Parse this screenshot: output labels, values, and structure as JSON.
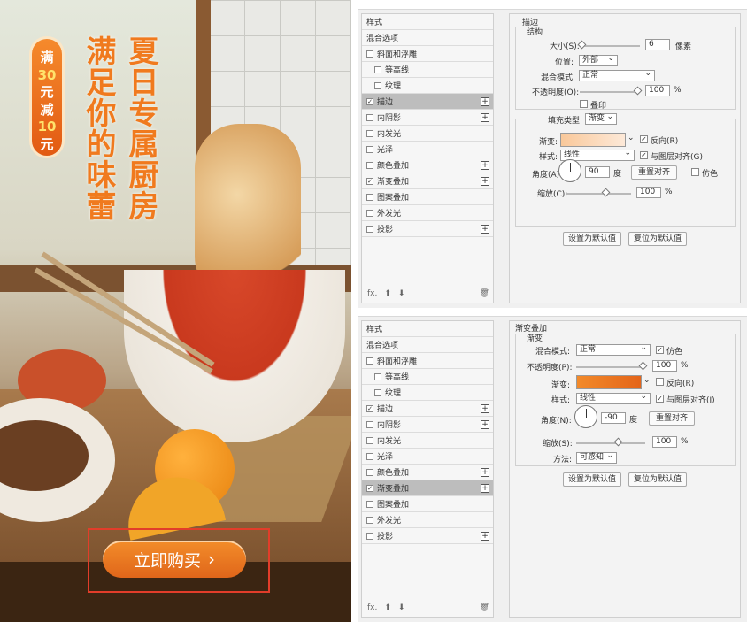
{
  "ad": {
    "tag": [
      "满",
      "30",
      "元",
      "减",
      "10",
      "元"
    ],
    "title_right": "夏日专属厨房",
    "title_left": "满足你的味蕾",
    "buy_label": "立即购买",
    "buy_icon": "chevron-right-icon",
    "brand_color": "#f07a1e"
  },
  "styles_list": [
    {
      "label": "样式",
      "check": false,
      "has_cb": false,
      "plus": false
    },
    {
      "label": "混合选项",
      "check": false,
      "has_cb": false,
      "plus": false
    },
    {
      "label": "斜面和浮雕",
      "check": false,
      "has_cb": true,
      "plus": false
    },
    {
      "label": "等高线",
      "check": false,
      "has_cb": true,
      "plus": false,
      "sub": true
    },
    {
      "label": "纹理",
      "check": false,
      "has_cb": true,
      "plus": false,
      "sub": true
    },
    {
      "label": "描边",
      "check": true,
      "has_cb": true,
      "plus": true
    },
    {
      "label": "内阴影",
      "check": false,
      "has_cb": true,
      "plus": true
    },
    {
      "label": "内发光",
      "check": false,
      "has_cb": true,
      "plus": false
    },
    {
      "label": "光泽",
      "check": false,
      "has_cb": true,
      "plus": false
    },
    {
      "label": "颜色叠加",
      "check": false,
      "has_cb": true,
      "plus": true
    },
    {
      "label": "渐变叠加",
      "check": true,
      "has_cb": true,
      "plus": true
    },
    {
      "label": "图案叠加",
      "check": false,
      "has_cb": true,
      "plus": false
    },
    {
      "label": "外发光",
      "check": false,
      "has_cb": true,
      "plus": false
    },
    {
      "label": "投影",
      "check": false,
      "has_cb": true,
      "plus": true
    }
  ],
  "footer": {
    "fx": "fx.",
    "up": "⬆",
    "down": "⬇",
    "trash": "🗑"
  },
  "stroke": {
    "title": "描边",
    "structure": "结构",
    "size_label": "大小(S):",
    "size_value": "6",
    "size_unit": "像素",
    "position_label": "位置:",
    "position_value": "外部",
    "blend_label": "混合模式:",
    "blend_value": "正常",
    "opacity_label": "不透明度(O):",
    "opacity_value": "100",
    "pct": "%",
    "overprint": "叠印",
    "fill_type_label": "填充类型:",
    "fill_type_value": "渐变",
    "gradient_label": "渐变:",
    "reverse": "反向(R)",
    "style_label": "样式:",
    "style_value": "线性",
    "align": "与图层对齐(G)",
    "angle_label": "角度(A):",
    "angle_value": "90",
    "deg": "度",
    "reset_align": "重置对齐",
    "dither": "仿色",
    "scale_label": "缩放(C):",
    "scale_value": "100",
    "make_default": "设置为默认值",
    "reset_default": "复位为默认值",
    "gradient_colors": [
      "#f9c89a",
      "#fde9d8"
    ]
  },
  "gradient_overlay": {
    "title": "渐变叠加",
    "section": "渐变",
    "blend_label": "混合模式:",
    "blend_value": "正常",
    "dither": "仿色",
    "opacity_label": "不透明度(P):",
    "opacity_value": "100",
    "pct": "%",
    "gradient_label": "渐变:",
    "reverse": "反向(R)",
    "style_label": "样式:",
    "style_value": "线性",
    "align": "与图层对齐(I)",
    "angle_label": "角度(N):",
    "angle_value": "-90",
    "deg": "度",
    "reset_align": "重置对齐",
    "scale_label": "缩放(S):",
    "scale_value": "100",
    "method_label": "方法:",
    "method_value": "可感知",
    "make_default": "设置为默认值",
    "reset_default": "复位为默认值",
    "gradient_colors": [
      "#f28a2a",
      "#e4651a"
    ]
  }
}
